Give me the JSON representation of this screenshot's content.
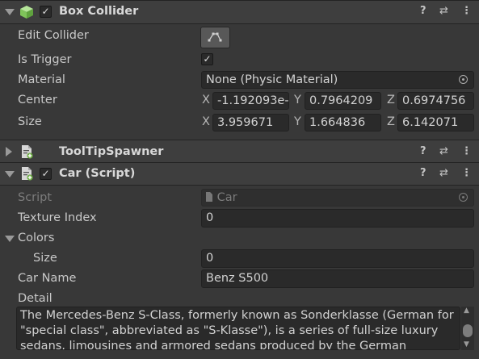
{
  "box_collider": {
    "title": "Box Collider",
    "edit_collider_label": "Edit Collider",
    "is_trigger_label": "Is Trigger",
    "is_trigger_value": "✓",
    "material_label": "Material",
    "material_value": "None (Physic Material)",
    "center_label": "Center",
    "center": {
      "x_label": "X",
      "x": "-1.192093e-",
      "y_label": "Y",
      "y": "0.7964209",
      "z_label": "Z",
      "z": "0.6974756"
    },
    "size_label": "Size",
    "size": {
      "x_label": "X",
      "x": "3.959671",
      "y_label": "Y",
      "y": "1.664836",
      "z_label": "Z",
      "z": "6.142071"
    }
  },
  "tooltip_spawner": {
    "title": "ToolTipSpawner"
  },
  "car_script": {
    "title": "Car (Script)",
    "script_label": "Script",
    "script_value": "Car",
    "texture_index_label": "Texture Index",
    "texture_index_value": "0",
    "colors_label": "Colors",
    "colors_size_label": "Size",
    "colors_size_value": "0",
    "car_name_label": "Car Name",
    "car_name_value": "Benz S500",
    "detail_label": "Detail",
    "detail_value": "The Mercedes-Benz S-Class, formerly known as Sonderklasse (German for \"special class\", abbreviated as \"S-Klasse\"), is a series of full-size luxury sedans, limousines and armored sedans produced by the German"
  },
  "icons": {
    "header_enabled_check": "✓",
    "help": "?",
    "presets": "⇄",
    "menu": "⋮",
    "scroll_up": "▲",
    "scroll_down": "▼"
  },
  "colors": {
    "background": "#383838",
    "header": "#3e3e3e",
    "field": "#2a2a2a",
    "collider_green": "#8ed16a"
  }
}
